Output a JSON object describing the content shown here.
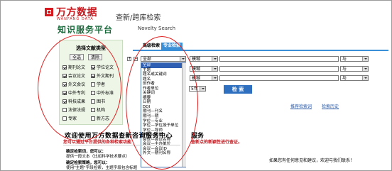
{
  "header": {
    "brand": "万方数据",
    "brand_en": "WANFANG DATA",
    "title": "查新/跨库检索",
    "platform": "知识服务平台",
    "platform_en": "Novelty Search"
  },
  "left_panel": {
    "title": "选择文献类型",
    "select_all": "全选",
    "clear": "清除",
    "types": [
      {
        "label": "期刊论文",
        "checked": true
      },
      {
        "label": "学位论文",
        "checked": true
      },
      {
        "label": "会议论文",
        "checked": true
      },
      {
        "label": "外文期刊",
        "checked": true
      },
      {
        "label": "外文会议",
        "checked": true
      },
      {
        "label": "学者",
        "checked": false
      },
      {
        "label": "中外专利",
        "checked": true
      },
      {
        "label": "中外标准",
        "checked": false
      },
      {
        "label": "科技成果",
        "checked": true
      },
      {
        "label": "图书",
        "checked": false
      },
      {
        "label": "法律法规",
        "checked": false
      },
      {
        "label": "机构",
        "checked": false
      },
      {
        "label": "专家",
        "checked": false
      },
      {
        "label": "新方志",
        "checked": false
      }
    ]
  },
  "tabs": [
    {
      "label": "高级检索",
      "active": false
    },
    {
      "label": "专业检索",
      "active": true
    }
  ],
  "search_rows": {
    "plus": "+",
    "minus": "−",
    "field_value": "全部",
    "match_value": "模糊",
    "logic_value": "与",
    "year_value": "5年"
  },
  "dropdown_options": [
    "全部",
    "主题",
    "题名或关键词",
    "题名",
    "创作者",
    "作者单位",
    "关键词",
    "摘要",
    "日期",
    "DOI",
    "期刊—刊名",
    "期刊—期",
    "学位—专业",
    "学位—学位授予单位",
    "学位—导师",
    "学位—学位",
    "会议—会议名称",
    "会议—主办单位",
    "会议—会议ID",
    "外文—期刊名称"
  ],
  "search_button": "检 索",
  "links": {
    "history": "检索历史",
    "recommend": "推荐检索词"
  },
  "welcome": {
    "title": "欢迎使用万方数据查新咨询服务中心",
    "title_tail": "服务",
    "notice": "您可以通过平台提供的各种检索功能",
    "notice_tail": "查新点的新颖性进行查证。"
  },
  "help": [
    {
      "text": "确定检索词，您可以：",
      "bold": true
    },
    {
      "text": "提供一段文本（比如科学技术要点）",
      "bold": false
    },
    {
      "text": "确定检索策略，您可以：",
      "bold": true
    },
    {
      "text": "使用\"主题\"字段检索，主题字段包含标题",
      "bold": false
    }
  ],
  "feedback": "如果您有任何意见和建议，欢迎与我们联系！",
  "accent_colors": {
    "brand_red": "#c8161d",
    "tab_blue": "#3b8fd6",
    "annotation_red": "#e02020"
  }
}
